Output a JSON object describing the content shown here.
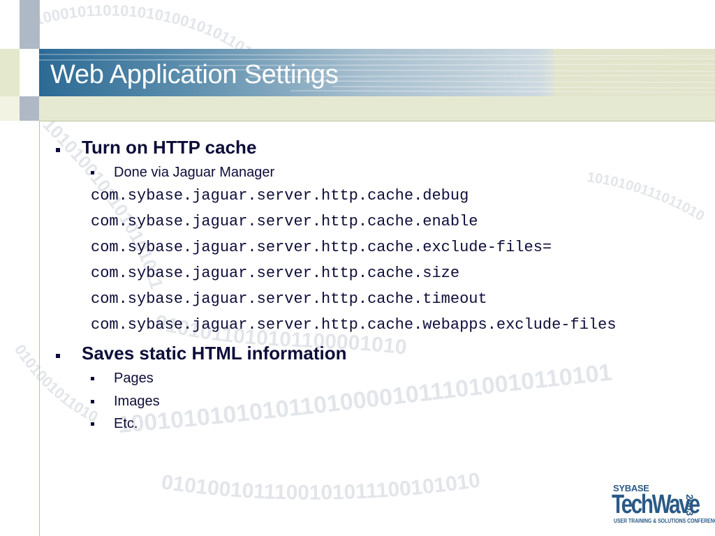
{
  "slide": {
    "title": "Web Application Settings",
    "bullets": [
      {
        "text": "Turn on HTTP cache",
        "sub": [
          "Done via Jaguar Manager"
        ],
        "code": [
          "com.sybase.jaguar.server.http.cache.debug",
          "com.sybase.jaguar.server.http.cache.enable",
          "com.sybase.jaguar.server.http.cache.exclude-files=",
          "com.sybase.jaguar.server.http.cache.size",
          "com.sybase.jaguar.server.http.cache.timeout",
          "com.sybase.jaguar.server.http.cache.webapps.exclude-files"
        ]
      },
      {
        "text": "Saves static HTML information",
        "sub": [
          "Pages",
          "Images",
          "Etc."
        ]
      }
    ]
  },
  "logo": {
    "brand": "SYBASE",
    "name": "TechWave",
    "year": "2003",
    "tagline": "USER TRAINING & SOLUTIONS CONFERENCE"
  },
  "colors": {
    "text": "#0d0d3a",
    "title_bar_start": "#2c6a95",
    "band": "#e6e9d2",
    "logo": "#2a5a86"
  }
}
